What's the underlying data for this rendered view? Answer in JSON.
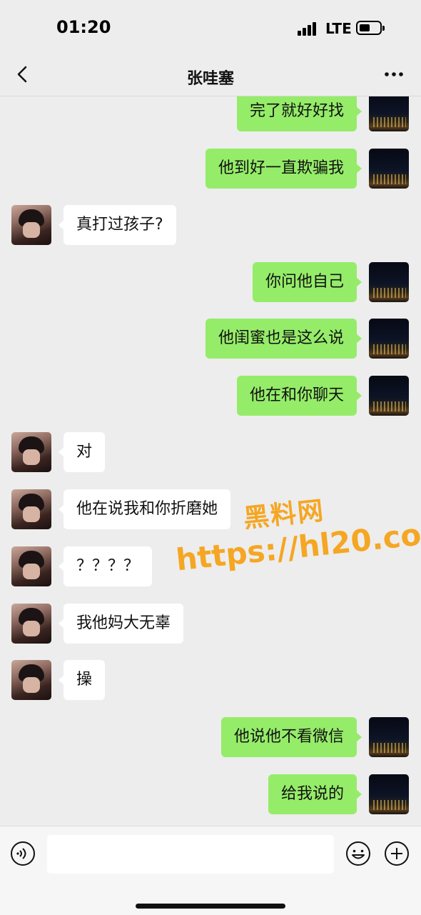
{
  "status_bar": {
    "time": "01:20",
    "network": "LTE",
    "signal_icon": "signal-bars-icon",
    "battery_icon": "battery-icon"
  },
  "nav": {
    "title": "张哇塞",
    "back_icon": "chevron-left-icon",
    "more_icon": "more-dots-icon"
  },
  "messages": [
    {
      "side": "self",
      "text": "完了就好好找"
    },
    {
      "side": "self",
      "text": "他到好一直欺骗我"
    },
    {
      "side": "other",
      "text": "真打过孩子?"
    },
    {
      "side": "self",
      "text": "你问他自己"
    },
    {
      "side": "self",
      "text": "他闺蜜也是这么说"
    },
    {
      "side": "self",
      "text": "他在和你聊天"
    },
    {
      "side": "other",
      "text": "对"
    },
    {
      "side": "other",
      "text": "他在说我和你折磨她"
    },
    {
      "side": "other",
      "text": "？？？？"
    },
    {
      "side": "other",
      "text": "我他妈大无辜"
    },
    {
      "side": "other",
      "text": "操"
    },
    {
      "side": "self",
      "text": "他说他不看微信"
    },
    {
      "side": "self",
      "text": "给我说的"
    }
  ],
  "watermark": {
    "line1": "黑料网",
    "line2": "https://hl20.co"
  },
  "input_bar": {
    "input_value": "",
    "voice_icon": "voice-icon",
    "emoji_icon": "emoji-icon",
    "plus_icon": "plus-circle-icon"
  },
  "colors": {
    "self_bubble": "#95ec69",
    "other_bubble": "#ffffff",
    "background": "#ededed",
    "watermark": "#f5a623"
  }
}
